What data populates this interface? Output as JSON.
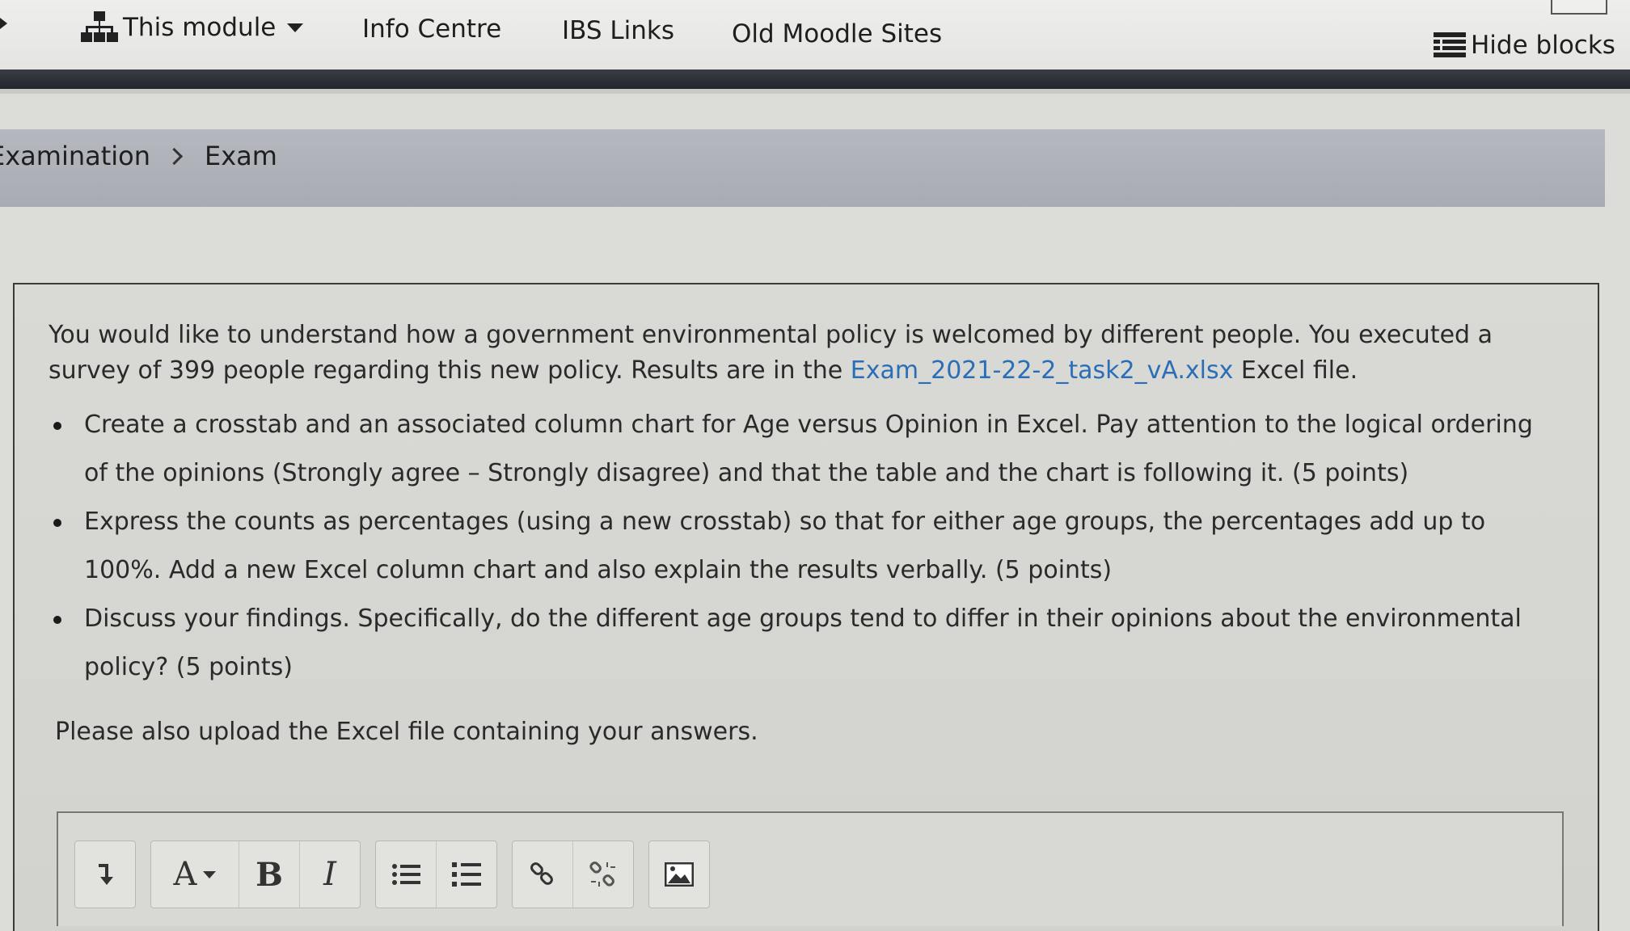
{
  "nav": {
    "module_label": "This module",
    "info_centre": "Info Centre",
    "ibs_links": "IBS Links",
    "old_moodle": "Old Moodle Sites",
    "hide_blocks": "Hide blocks"
  },
  "breadcrumb": {
    "items": [
      "Examination",
      "Exam"
    ]
  },
  "question": {
    "intro_before_link": "You would like to understand how a government environmental policy is welcomed by different people. You executed a survey of 399 people regarding this new policy. Results are in the ",
    "link_text": "Exam_2021-22-2_task2_vA.xlsx",
    "intro_after_link": " Excel file.",
    "tasks": [
      "Create a crosstab and an associated column chart for Age versus Opinion in Excel. Pay attention to the logical ordering of the opinions (Strongly agree – Strongly disagree) and that the table and the chart is following it. (5 points)",
      "Express the counts as percentages (using a new crosstab) so that for either age groups, the percentages add up to 100%. Add a new Excel column chart and also explain the results verbally. (5 points)",
      "Discuss your findings. Specifically, do the different age groups tend to differ in their opinions about the environmental policy? (5 points)"
    ],
    "upload_note": "Please also upload the Excel file containing your answers."
  },
  "editor": {
    "toolbar": {
      "expand_icon": "expand-toolbar-icon",
      "font_label": "A",
      "bold_label": "B",
      "italic_label": "I"
    }
  },
  "colors": {
    "link": "#2a6eb8",
    "nav_bar": "#2b2e35",
    "breadcrumb_band": "#b0b2ba"
  }
}
